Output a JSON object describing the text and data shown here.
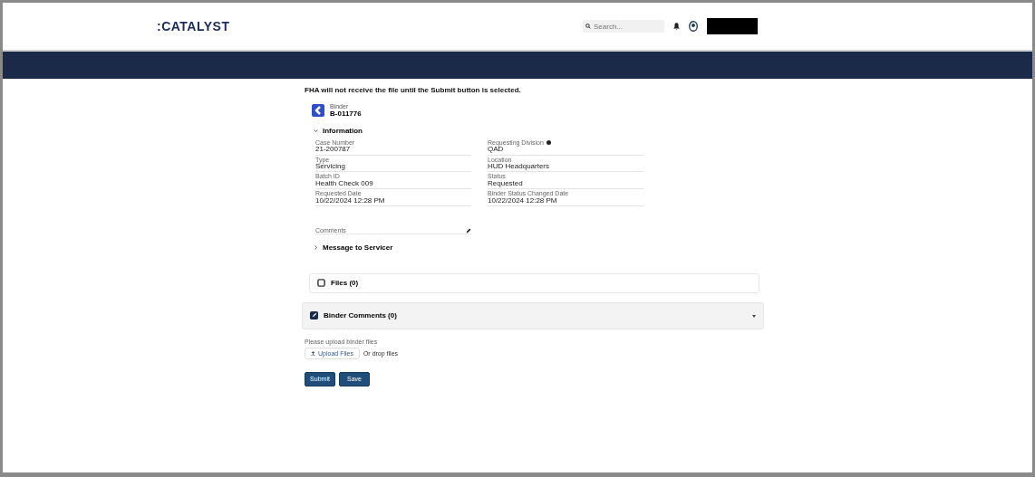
{
  "header": {
    "logo": ":CATALYST",
    "search": {
      "placeholder": "Search..."
    }
  },
  "notice": "FHA will not receive the file until the Submit button is selected.",
  "record": {
    "type_label": "Binder",
    "title": "B-011776"
  },
  "information": {
    "title": "Information",
    "expanded": true,
    "fields": [
      {
        "label": "Case Number",
        "value": "21-200787"
      },
      {
        "label": "Requesting Division",
        "value": "QAD",
        "info": true
      },
      {
        "label": "Type",
        "value": "Servicing"
      },
      {
        "label": "Location",
        "value": "HUD Headquarters"
      },
      {
        "label": "Batch ID",
        "value": "Health Check 009"
      },
      {
        "label": "Status",
        "value": "Requested"
      },
      {
        "label": "Requested Date",
        "value": "10/22/2024 12:28 PM"
      },
      {
        "label": "Binder Status Changed Date",
        "value": "10/22/2024 12:28 PM"
      }
    ],
    "comments_label": "Comments"
  },
  "message_section": {
    "title": "Message to Servicer",
    "expanded": false
  },
  "cards": [
    {
      "title": "Files (0)",
      "kind": "plain"
    },
    {
      "title": "Binder Comments (0)",
      "kind": "shaded"
    }
  ],
  "upload": {
    "label": "Please upload binder files",
    "button": "Upload Files",
    "drop": "Or drop files"
  },
  "buttons": [
    "Submit",
    "Save"
  ]
}
